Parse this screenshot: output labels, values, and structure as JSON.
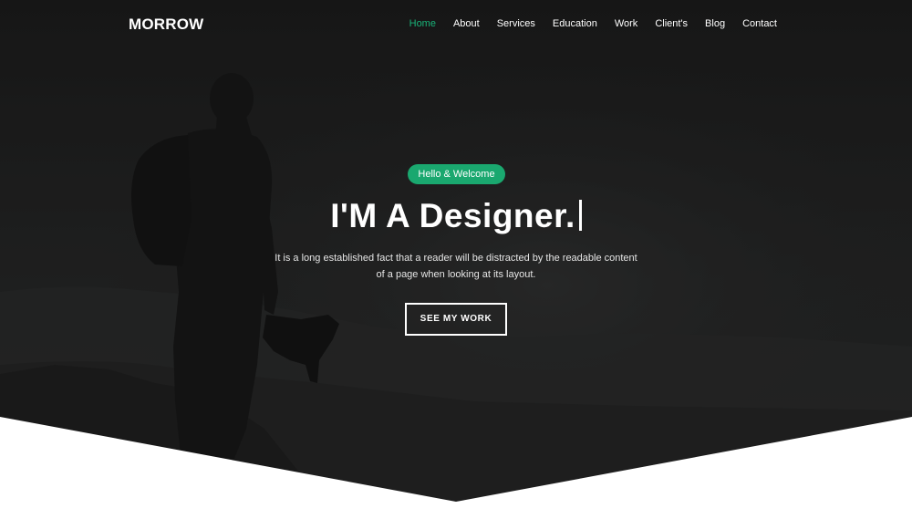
{
  "brand": {
    "name": "MORROW"
  },
  "nav": {
    "items": [
      {
        "label": "Home",
        "active": true
      },
      {
        "label": "About",
        "active": false
      },
      {
        "label": "Services",
        "active": false
      },
      {
        "label": "Education",
        "active": false
      },
      {
        "label": "Work",
        "active": false
      },
      {
        "label": "Client's",
        "active": false
      },
      {
        "label": "Blog",
        "active": false
      },
      {
        "label": "Contact",
        "active": false
      }
    ]
  },
  "hero": {
    "badge": "Hello & Welcome",
    "headline": "I'M A Designer.",
    "description": "It is a long established fact that a reader will be distracted by the readable content of a page when looking at its layout.",
    "cta_label": "SEE MY WORK"
  },
  "colors": {
    "accent": "#1aa86f",
    "overlay": "#1c1c1c",
    "text": "#ffffff"
  }
}
